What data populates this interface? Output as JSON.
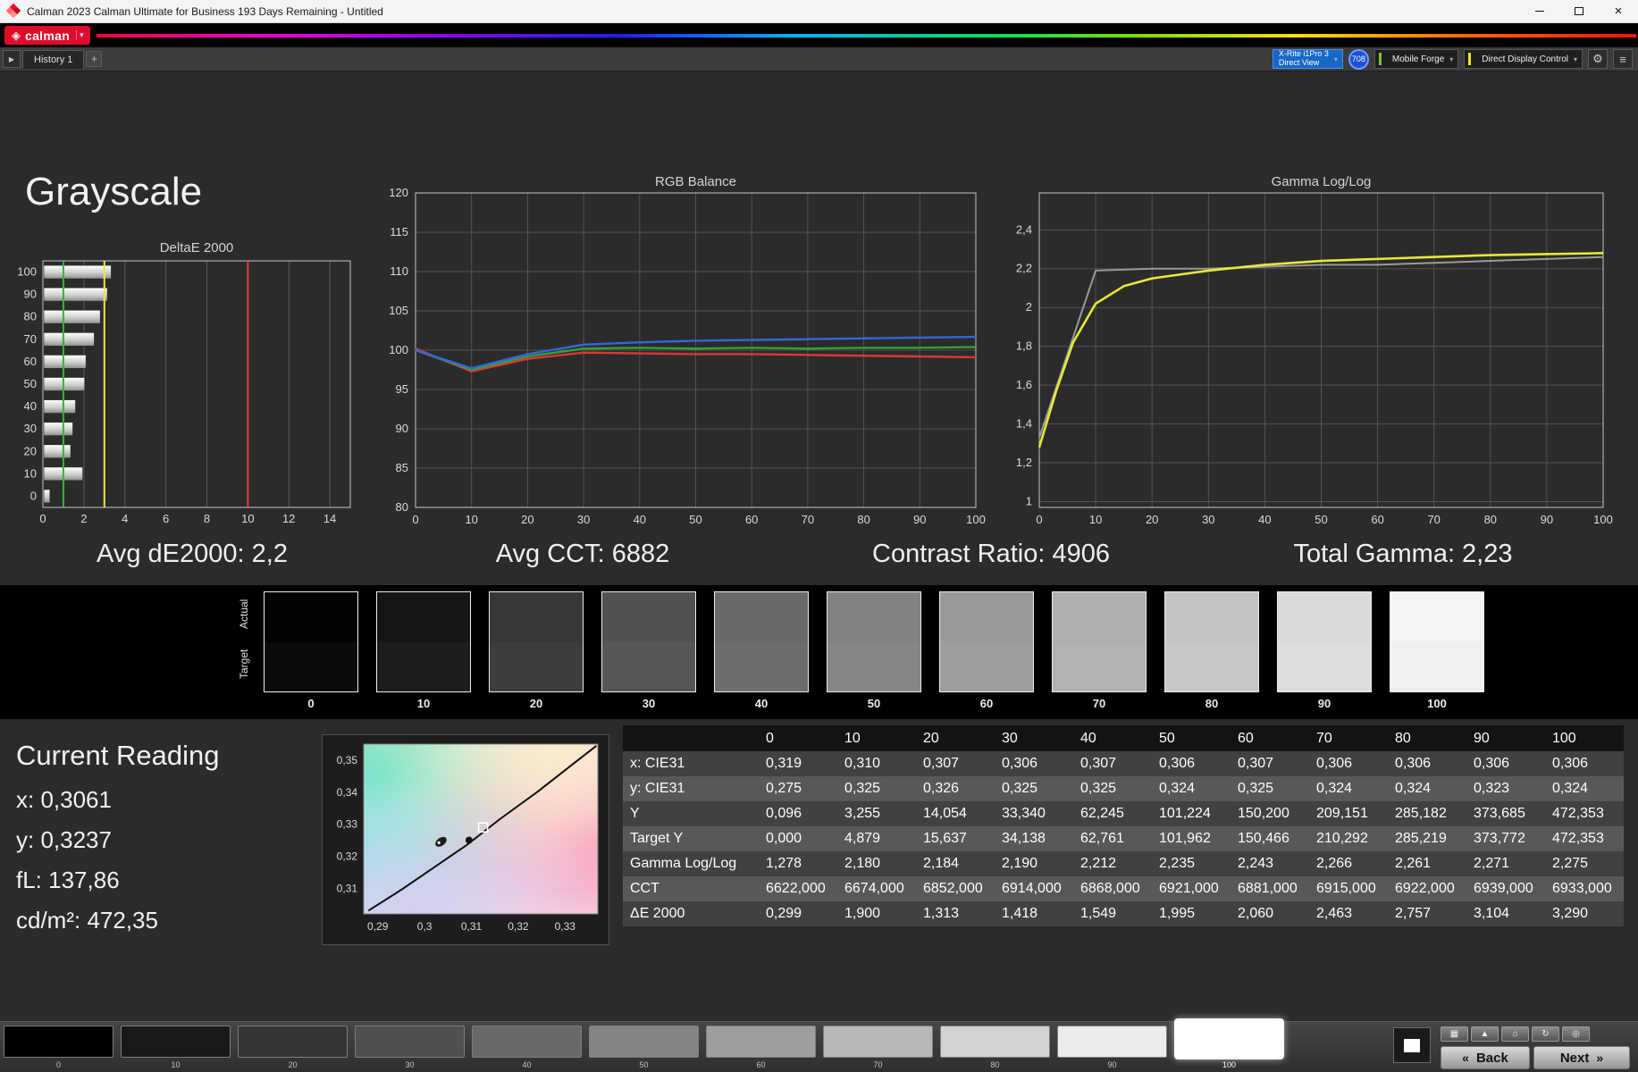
{
  "window": {
    "title": "Calman 2023 Calman Ultimate for Business 193 Days Remaining  - Untitled",
    "brand": "calman"
  },
  "icons": {
    "logo_diamond": "◈",
    "dropdown": "▾",
    "close": "×",
    "gear": "⚙",
    "sliders": "≡",
    "play": "▶",
    "add": "+",
    "back": "«",
    "next": "»"
  },
  "tabbar": {
    "tab": "History 1"
  },
  "toolbar": {
    "meter": {
      "line1": "X-Rite i1Pro 3",
      "line2": "Direct View"
    },
    "badge": "708",
    "workflow": "Mobile Forge",
    "display": "Direct Display Control"
  },
  "page": {
    "title": "Grayscale",
    "stats": {
      "avg_de2000": "Avg dE2000: 2,2",
      "avg_cct": "Avg CCT: 6882",
      "contrast_ratio": "Contrast Ratio: 4906",
      "total_gamma": "Total Gamma: 2,23"
    }
  },
  "chart_data": [
    {
      "id": "deltae",
      "type": "bar",
      "orientation": "horizontal",
      "title": "DeltaE 2000",
      "categories": [
        "100",
        "90",
        "80",
        "70",
        "60",
        "50",
        "40",
        "30",
        "20",
        "10",
        "0"
      ],
      "values": [
        3.29,
        3.104,
        2.757,
        2.463,
        2.06,
        1.995,
        1.549,
        1.418,
        1.313,
        1.9,
        0.299
      ],
      "xlim": [
        0,
        15
      ],
      "xticks": [
        0,
        2,
        4,
        6,
        8,
        10,
        12,
        14
      ],
      "reference_lines": [
        {
          "name": "good-limit",
          "value": 1,
          "color": "#3fae3f"
        },
        {
          "name": "warn-limit",
          "value": 3,
          "color": "#e8e840"
        },
        {
          "name": "fail-limit",
          "value": 10,
          "color": "#e04040"
        }
      ]
    },
    {
      "id": "rgb",
      "type": "line",
      "title": "RGB Balance",
      "x": [
        0,
        10,
        20,
        30,
        40,
        50,
        60,
        70,
        80,
        90,
        100
      ],
      "ylim": [
        80,
        120
      ],
      "yticks": [
        80,
        85,
        90,
        95,
        100,
        105,
        110,
        115,
        120
      ],
      "xticks": [
        0,
        10,
        20,
        30,
        40,
        50,
        60,
        70,
        80,
        90,
        100
      ],
      "series": [
        {
          "name": "red",
          "color": "#e03535",
          "values": [
            100.2,
            97.3,
            98.9,
            99.7,
            99.6,
            99.5,
            99.5,
            99.4,
            99.3,
            99.2,
            99.1
          ]
        },
        {
          "name": "green",
          "color": "#35a035",
          "values": [
            100.0,
            97.5,
            99.2,
            100.2,
            100.3,
            100.2,
            100.3,
            100.2,
            100.3,
            100.3,
            100.4
          ]
        },
        {
          "name": "blue",
          "color": "#3565e0",
          "values": [
            100.0,
            97.7,
            99.5,
            100.7,
            101.0,
            101.2,
            101.3,
            101.4,
            101.5,
            101.6,
            101.7
          ]
        }
      ]
    },
    {
      "id": "gamma",
      "type": "line",
      "title": "Gamma Log/Log",
      "ylim": [
        0.97,
        2.59
      ],
      "yticks": [
        1,
        1.2,
        1.4,
        1.6,
        1.8,
        2,
        2.2,
        2.4
      ],
      "ytick_labels": [
        "1",
        "1,2",
        "1,4",
        "1,6",
        "1,8",
        "2",
        "2,2",
        "2,4"
      ],
      "xticks": [
        0,
        10,
        20,
        30,
        40,
        50,
        60,
        70,
        80,
        90,
        100
      ],
      "series": [
        {
          "name": "target",
          "color": "#9a9a9a",
          "points": [
            [
              0,
              1.33
            ],
            [
              10,
              2.19
            ],
            [
              20,
              2.2
            ],
            [
              30,
              2.2
            ],
            [
              40,
              2.21
            ],
            [
              50,
              2.22
            ],
            [
              60,
              2.22
            ],
            [
              70,
              2.23
            ],
            [
              80,
              2.24
            ],
            [
              90,
              2.25
            ],
            [
              100,
              2.26
            ]
          ]
        },
        {
          "name": "measured",
          "color": "#e8e83a",
          "points": [
            [
              0,
              1.28
            ],
            [
              3,
              1.57
            ],
            [
              6,
              1.82
            ],
            [
              10,
              2.02
            ],
            [
              15,
              2.11
            ],
            [
              20,
              2.15
            ],
            [
              30,
              2.19
            ],
            [
              40,
              2.22
            ],
            [
              50,
              2.24
            ],
            [
              60,
              2.25
            ],
            [
              70,
              2.26
            ],
            [
              80,
              2.27
            ],
            [
              90,
              2.275
            ],
            [
              100,
              2.28
            ]
          ]
        }
      ]
    },
    {
      "id": "cie",
      "type": "scatter",
      "title": "CIE 1931 chromaticity",
      "xlim": [
        0.287,
        0.337
      ],
      "ylim": [
        0.302,
        0.355
      ],
      "xticks": [
        0.29,
        0.3,
        0.31,
        0.32,
        0.33
      ],
      "xtick_labels": [
        "0,29",
        "0,3",
        "0,31",
        "0,32",
        "0,33"
      ],
      "yticks": [
        0.31,
        0.32,
        0.33,
        0.34,
        0.35
      ],
      "ytick_labels": [
        "0,31",
        "0,32",
        "0,33",
        "0,34",
        "0,35"
      ],
      "locus": [
        [
          0.288,
          0.303
        ],
        [
          0.295,
          0.3095
        ],
        [
          0.302,
          0.3165
        ],
        [
          0.309,
          0.3235
        ],
        [
          0.316,
          0.3315
        ],
        [
          0.324,
          0.34
        ],
        [
          0.331,
          0.348
        ],
        [
          0.3367,
          0.3545
        ]
      ],
      "markers": [
        {
          "name": "target",
          "shape": "square",
          "x": 0.3125,
          "y": 0.329
        },
        {
          "name": "actual",
          "shape": "circle",
          "x": 0.3095,
          "y": 0.325
        },
        {
          "name": "probe",
          "shape": "probe",
          "x": 0.3035,
          "y": 0.3245
        }
      ]
    }
  ],
  "swatches": {
    "row_labels": [
      "Actual",
      "Target"
    ],
    "items": [
      {
        "label": "0",
        "actual": "#020202",
        "target": "#0b0b0b"
      },
      {
        "label": "10",
        "actual": "#151515",
        "target": "#1c1c1c"
      },
      {
        "label": "20",
        "actual": "#373737",
        "target": "#3c3c3c"
      },
      {
        "label": "30",
        "actual": "#515151",
        "target": "#565656"
      },
      {
        "label": "40",
        "actual": "#696969",
        "target": "#6d6d6d"
      },
      {
        "label": "50",
        "actual": "#828282",
        "target": "#868686"
      },
      {
        "label": "60",
        "actual": "#999999",
        "target": "#9d9d9d"
      },
      {
        "label": "70",
        "actual": "#afafaf",
        "target": "#b3b3b3"
      },
      {
        "label": "80",
        "actual": "#c4c4c4",
        "target": "#c8c8c8"
      },
      {
        "label": "90",
        "actual": "#dadada",
        "target": "#dddddd"
      },
      {
        "label": "100",
        "actual": "#f4f4f4",
        "target": "#f0f0f0"
      }
    ]
  },
  "current_reading": {
    "title": "Current Reading",
    "x": "x: 0,3061",
    "y": "y: 0,3237",
    "fl": "fL: 137,86",
    "cdm2": "cd/m²: 472,35"
  },
  "table": {
    "columns": [
      "",
      "0",
      "10",
      "20",
      "30",
      "40",
      "50",
      "60",
      "70",
      "80",
      "90",
      "100"
    ],
    "rows": [
      {
        "label": "x: CIE31",
        "values": [
          "0,319",
          "0,310",
          "0,307",
          "0,306",
          "0,307",
          "0,306",
          "0,307",
          "0,306",
          "0,306",
          "0,306",
          "0,306"
        ]
      },
      {
        "label": "y: CIE31",
        "values": [
          "0,275",
          "0,325",
          "0,326",
          "0,325",
          "0,325",
          "0,324",
          "0,325",
          "0,324",
          "0,324",
          "0,323",
          "0,324"
        ]
      },
      {
        "label": "Y",
        "values": [
          "0,096",
          "3,255",
          "14,054",
          "33,340",
          "62,245",
          "101,224",
          "150,200",
          "209,151",
          "285,182",
          "373,685",
          "472,353"
        ]
      },
      {
        "label": "Target Y",
        "values": [
          "0,000",
          "4,879",
          "15,637",
          "34,138",
          "62,761",
          "101,962",
          "150,466",
          "210,292",
          "285,219",
          "373,772",
          "472,353"
        ]
      },
      {
        "label": "Gamma Log/Log",
        "values": [
          "1,278",
          "2,180",
          "2,184",
          "2,190",
          "2,212",
          "2,235",
          "2,243",
          "2,266",
          "2,261",
          "2,271",
          "2,275"
        ]
      },
      {
        "label": "CCT",
        "values": [
          "6622,000",
          "6674,000",
          "6852,000",
          "6914,000",
          "6868,000",
          "6921,000",
          "6881,000",
          "6915,000",
          "6922,000",
          "6939,000",
          "6933,000"
        ]
      },
      {
        "label": "ΔE 2000",
        "values": [
          "0,299",
          "1,900",
          "1,313",
          "1,418",
          "1,549",
          "1,995",
          "2,060",
          "2,463",
          "2,757",
          "3,104",
          "3,290"
        ]
      }
    ]
  },
  "bottom": {
    "patches": [
      {
        "label": "0",
        "color": "#000000"
      },
      {
        "label": "10",
        "color": "#191919"
      },
      {
        "label": "20",
        "color": "#343434"
      },
      {
        "label": "30",
        "color": "#4f4f4f"
      },
      {
        "label": "40",
        "color": "#696969"
      },
      {
        "label": "50",
        "color": "#848484"
      },
      {
        "label": "60",
        "color": "#9e9e9e"
      },
      {
        "label": "70",
        "color": "#b8b8b8"
      },
      {
        "label": "80",
        "color": "#d2d2d2"
      },
      {
        "label": "90",
        "color": "#ececec"
      },
      {
        "label": "100",
        "color": "#ffffff",
        "selected": true
      }
    ],
    "tools": [
      {
        "name": "display-tool",
        "icon": "▦"
      },
      {
        "name": "up-tool",
        "icon": "▲"
      },
      {
        "name": "home-tool",
        "icon": "⌂"
      },
      {
        "name": "refresh-tool",
        "icon": "↻"
      },
      {
        "name": "target-tool",
        "icon": "◎"
      }
    ],
    "back_label": "Back",
    "next_label": "Next"
  }
}
